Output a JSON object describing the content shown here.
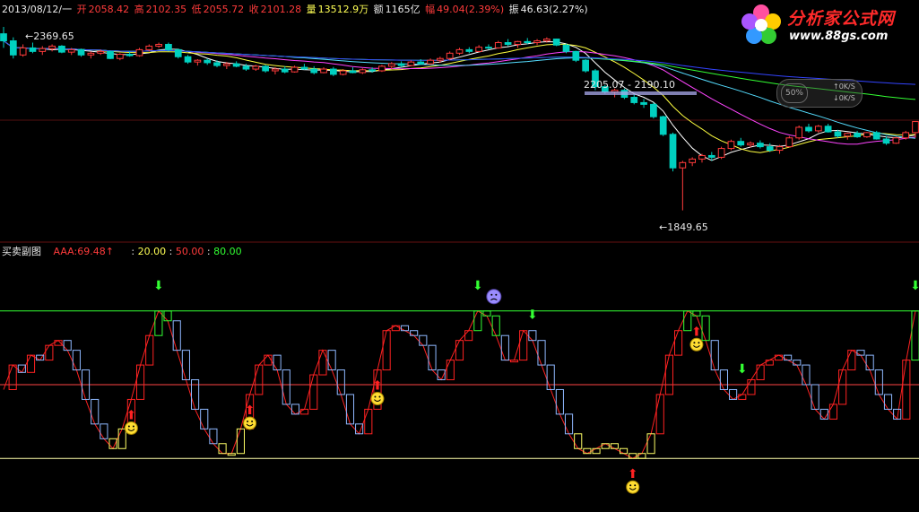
{
  "header": {
    "date": "2013/08/12/一",
    "open_label": "开",
    "open": "2058.42",
    "high_label": "高",
    "high": "2102.35",
    "low_label": "低",
    "low": "2055.72",
    "close_label": "收",
    "close": "2101.28",
    "volume_label": "量",
    "volume": "13512.9万",
    "amount_label": "额",
    "amount": "1165亿",
    "change_label": "幅",
    "change": "49.04(2.39%)",
    "amplitude_label": "振",
    "amplitude": "46.63(2.27%)"
  },
  "logo": {
    "title": "分析家公式网",
    "url": "www.88gs.com"
  },
  "widget": {
    "percent": "50%",
    "speed_up": "0K/S",
    "speed_down": "0K/S"
  },
  "main_labels": {
    "high_mark": "2369.65",
    "mid_mark": "2205.07 - 2190.10",
    "low_mark": "1849.65"
  },
  "indicator": {
    "name": "买卖副图",
    "series_label": "AAA:",
    "series_value": "69.48",
    "series_arrow": "↑",
    "levels_prefix": ":",
    "level1": "20.00",
    "level2": "50.00",
    "level3": "80.00"
  },
  "colors": {
    "up": "#ff3b3b",
    "down": "#00d0c0",
    "ma5": "#ffffff",
    "ma10": "#ffff40",
    "ma20": "#ff44ff",
    "ma30": "#55ddff",
    "ma60": "#33ff33",
    "ma120": "#3344ff",
    "line80": "#33ff33",
    "line50": "#ff4444",
    "line20": "#ffffaa"
  },
  "chart_data": [
    {
      "type": "candlestick",
      "title": "",
      "ylim": [
        1780,
        2400
      ],
      "series_ohlc": [
        [
          2350,
          2369.65,
          2310,
          2330
        ],
        [
          2330,
          2340,
          2280,
          2290
        ],
        [
          2290,
          2320,
          2285,
          2310
        ],
        [
          2310,
          2325,
          2295,
          2300
        ],
        [
          2300,
          2315,
          2290,
          2308
        ],
        [
          2308,
          2320,
          2300,
          2315
        ],
        [
          2315,
          2318,
          2295,
          2298
        ],
        [
          2298,
          2310,
          2290,
          2305
        ],
        [
          2305,
          2308,
          2285,
          2290
        ],
        [
          2290,
          2300,
          2280,
          2295
        ],
        [
          2295,
          2305,
          2290,
          2300
        ],
        [
          2300,
          2302,
          2278,
          2280
        ],
        [
          2280,
          2295,
          2275,
          2292
        ],
        [
          2292,
          2300,
          2285,
          2288
        ],
        [
          2288,
          2310,
          2285,
          2305
        ],
        [
          2305,
          2320,
          2300,
          2315
        ],
        [
          2315,
          2325,
          2310,
          2320
        ],
        [
          2320,
          2325,
          2300,
          2305
        ],
        [
          2305,
          2308,
          2280,
          2285
        ],
        [
          2285,
          2290,
          2265,
          2270
        ],
        [
          2270,
          2278,
          2260,
          2275
        ],
        [
          2275,
          2280,
          2262,
          2268
        ],
        [
          2268,
          2275,
          2255,
          2260
        ],
        [
          2260,
          2270,
          2250,
          2265
        ],
        [
          2265,
          2272,
          2255,
          2258
        ],
        [
          2258,
          2265,
          2245,
          2250
        ],
        [
          2250,
          2262,
          2245,
          2258
        ],
        [
          2258,
          2262,
          2240,
          2245
        ],
        [
          2245,
          2255,
          2235,
          2250
        ],
        [
          2250,
          2258,
          2238,
          2242
        ],
        [
          2242,
          2260,
          2240,
          2255
        ],
        [
          2255,
          2265,
          2248,
          2250
        ],
        [
          2250,
          2258,
          2235,
          2240
        ],
        [
          2240,
          2255,
          2238,
          2250
        ],
        [
          2250,
          2256,
          2230,
          2235
        ],
        [
          2235,
          2250,
          2232,
          2245
        ],
        [
          2245,
          2255,
          2238,
          2240
        ],
        [
          2240,
          2252,
          2236,
          2248
        ],
        [
          2248,
          2255,
          2240,
          2245
        ],
        [
          2245,
          2262,
          2242,
          2258
        ],
        [
          2258,
          2270,
          2250,
          2265
        ],
        [
          2265,
          2272,
          2255,
          2260
        ],
        [
          2260,
          2275,
          2258,
          2270
        ],
        [
          2270,
          2278,
          2262,
          2265
        ],
        [
          2265,
          2280,
          2262,
          2275
        ],
        [
          2275,
          2285,
          2268,
          2280
        ],
        [
          2280,
          2300,
          2275,
          2295
        ],
        [
          2295,
          2310,
          2290,
          2305
        ],
        [
          2305,
          2312,
          2295,
          2300
        ],
        [
          2300,
          2318,
          2298,
          2312
        ],
        [
          2312,
          2320,
          2305,
          2310
        ],
        [
          2310,
          2330,
          2308,
          2325
        ],
        [
          2325,
          2335,
          2315,
          2320
        ],
        [
          2320,
          2330,
          2310,
          2328
        ],
        [
          2328,
          2338,
          2320,
          2325
        ],
        [
          2325,
          2335,
          2318,
          2330
        ],
        [
          2330,
          2340,
          2325,
          2335
        ],
        [
          2335,
          2336,
          2315,
          2318
        ],
        [
          2318,
          2322,
          2295,
          2300
        ],
        [
          2300,
          2302,
          2270,
          2275
        ],
        [
          2275,
          2278,
          2240,
          2245
        ],
        [
          2245,
          2250,
          2190.1,
          2200
        ],
        [
          2200,
          2205.07,
          2180,
          2185
        ],
        [
          2185,
          2195,
          2170,
          2190
        ],
        [
          2190,
          2195,
          2165,
          2170
        ],
        [
          2170,
          2178,
          2150,
          2155
        ],
        [
          2155,
          2165,
          2140,
          2150
        ],
        [
          2150,
          2155,
          2110,
          2115
        ],
        [
          2115,
          2118,
          2060,
          2065
        ],
        [
          2065,
          2070,
          1960,
          1970
        ],
        [
          1970,
          1990,
          1849.65,
          1985
        ],
        [
          1985,
          2000,
          1975,
          1995
        ],
        [
          1995,
          2010,
          1985,
          2005
        ],
        [
          2005,
          2015,
          1990,
          2000
        ],
        [
          2000,
          2030,
          1995,
          2025
        ],
        [
          2025,
          2050,
          2020,
          2045
        ],
        [
          2045,
          2055,
          2030,
          2035
        ],
        [
          2035,
          2045,
          2028,
          2040
        ],
        [
          2040,
          2048,
          2025,
          2030
        ],
        [
          2030,
          2040,
          2015,
          2020
        ],
        [
          2020,
          2035,
          2010,
          2030
        ],
        [
          2030,
          2060,
          2028,
          2055
        ],
        [
          2055,
          2090,
          2050,
          2085
        ],
        [
          2085,
          2095,
          2070,
          2075
        ],
        [
          2075,
          2092,
          2070,
          2088
        ],
        [
          2088,
          2095,
          2070,
          2072
        ],
        [
          2072,
          2078,
          2055,
          2060
        ],
        [
          2060,
          2070,
          2050,
          2068
        ],
        [
          2068,
          2075,
          2055,
          2058
        ],
        [
          2058,
          2072,
          2055,
          2070
        ],
        [
          2070,
          2075,
          2050,
          2052
        ],
        [
          2052,
          2060,
          2035,
          2040
        ],
        [
          2040,
          2058,
          2038,
          2055
        ],
        [
          2055,
          2075,
          2050,
          2070
        ],
        [
          2070,
          2102.35,
          2055.72,
          2101.28
        ]
      ],
      "annotations": [
        "2369.65",
        "2205.07 - 2190.10",
        "1849.65"
      ]
    },
    {
      "type": "line",
      "title": "买卖副图",
      "ylim": [
        0,
        100
      ],
      "levels": [
        20,
        50,
        80
      ],
      "series": [
        {
          "name": "AAA",
          "values": [
            48,
            58,
            55,
            62,
            60,
            66,
            68,
            64,
            56,
            44,
            34,
            28,
            24,
            32,
            44,
            58,
            70,
            80,
            76,
            64,
            52,
            40,
            32,
            26,
            22,
            22,
            32,
            46,
            58,
            62,
            56,
            42,
            38,
            40,
            54,
            64,
            56,
            46,
            34,
            30,
            40,
            56,
            72,
            74,
            72,
            70,
            66,
            56,
            52,
            60,
            68,
            72,
            80,
            78,
            70,
            60,
            60,
            72,
            68,
            58,
            48,
            38,
            30,
            24,
            22,
            24,
            26,
            24,
            22,
            20,
            22,
            30,
            46,
            62,
            72,
            80,
            78,
            68,
            56,
            48,
            44,
            46,
            52,
            58,
            60,
            62,
            60,
            58,
            50,
            40,
            36,
            42,
            56,
            64,
            62,
            56,
            46,
            40,
            36,
            60,
            80
          ]
        }
      ],
      "sell_markers": [
        17,
        52,
        58,
        81,
        100
      ],
      "buy_markers": [
        14,
        27,
        41,
        69,
        76
      ]
    }
  ]
}
